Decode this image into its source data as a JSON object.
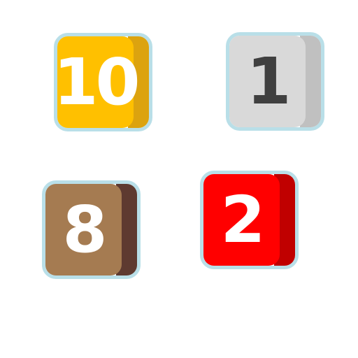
{
  "tiles": [
    {
      "value": "10",
      "face": "#ffc000",
      "shade": "#dca30f",
      "text": "#ffffff"
    },
    {
      "value": "1",
      "face": "#d9d9d9",
      "shade": "#c0c0c0",
      "text": "#404040"
    },
    {
      "value": "8",
      "face": "#a57b51",
      "shade": "#5e3a30",
      "text": "#ffffff"
    },
    {
      "value": "2",
      "face": "#ff0000",
      "shade": "#c00000",
      "text": "#ffffff"
    }
  ],
  "border_color": "#b9dfe8"
}
